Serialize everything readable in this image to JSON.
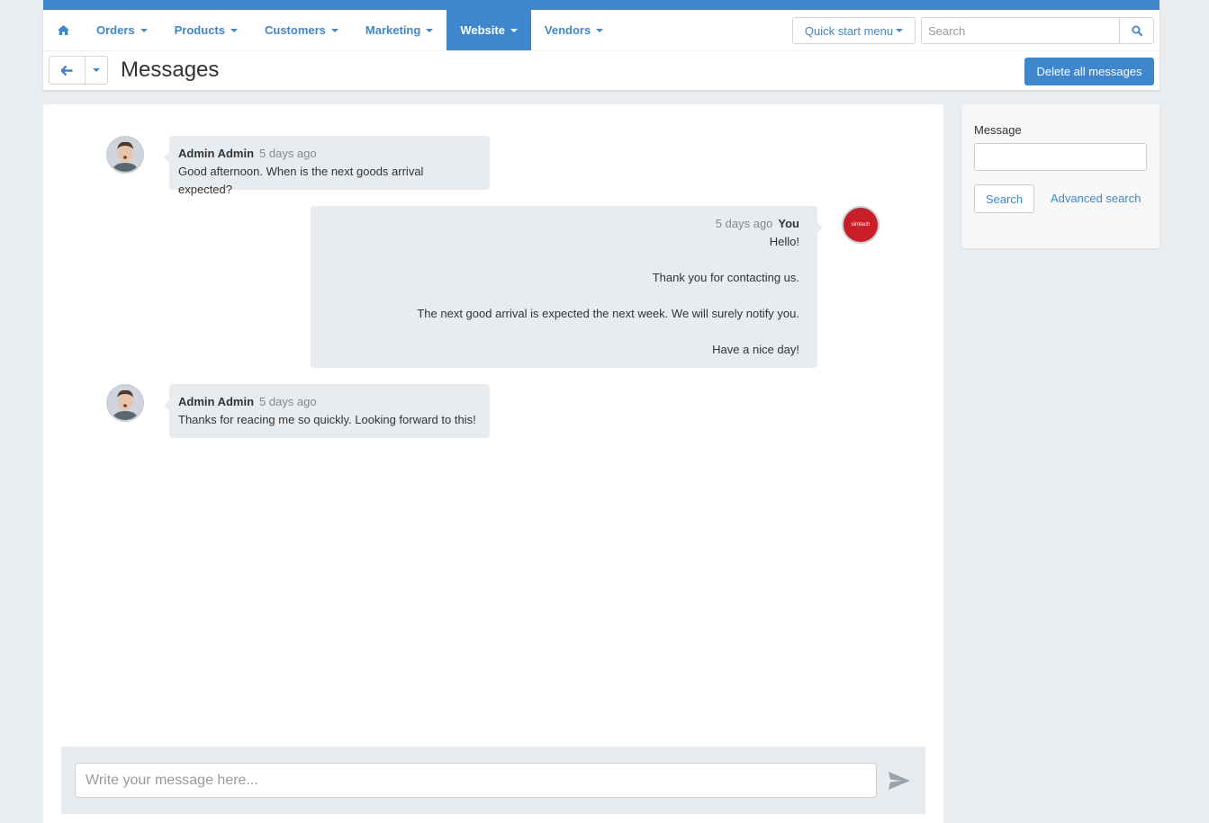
{
  "colors": {
    "accent": "#3f87cc",
    "bubble": "#e8ecef",
    "page_bg": "#e9edf0",
    "brand_avatar": "#c81e2a"
  },
  "nav": {
    "home_icon": "home-icon",
    "items": [
      {
        "label": "Orders",
        "active": false
      },
      {
        "label": "Products",
        "active": false
      },
      {
        "label": "Customers",
        "active": false
      },
      {
        "label": "Marketing",
        "active": false
      },
      {
        "label": "Website",
        "active": true
      },
      {
        "label": "Vendors",
        "active": false
      }
    ],
    "quick_start_label": "Quick start menu",
    "search_placeholder": "Search",
    "search_icon": "search-icon"
  },
  "page": {
    "title": "Messages",
    "back_icon": "arrow-left-icon",
    "delete_all_label": "Delete all messages"
  },
  "messages": [
    {
      "author": "Admin Admin",
      "time": "5 days ago",
      "lines": [
        "Good afternoon. When is the next goods arrival expected?"
      ],
      "side": "left"
    },
    {
      "author": "You",
      "time": "5 days ago",
      "lines": [
        "Hello!",
        "",
        "Thank you for contacting us.",
        "",
        "The next good arrival is expected the next week. We will surely notify you.",
        "",
        "Have a nice day!"
      ],
      "side": "right",
      "avatar_logo_text": "simtech"
    },
    {
      "author": "Admin Admin",
      "time": "5 days ago",
      "lines": [
        "Thanks for reacing me so quickly. Looking forward to this!"
      ],
      "side": "left"
    }
  ],
  "composer": {
    "placeholder": "Write your message here...",
    "send_icon": "send-icon"
  },
  "sidebar": {
    "message_label": "Message",
    "search_label": "Search",
    "advanced_search_label": "Advanced search"
  }
}
